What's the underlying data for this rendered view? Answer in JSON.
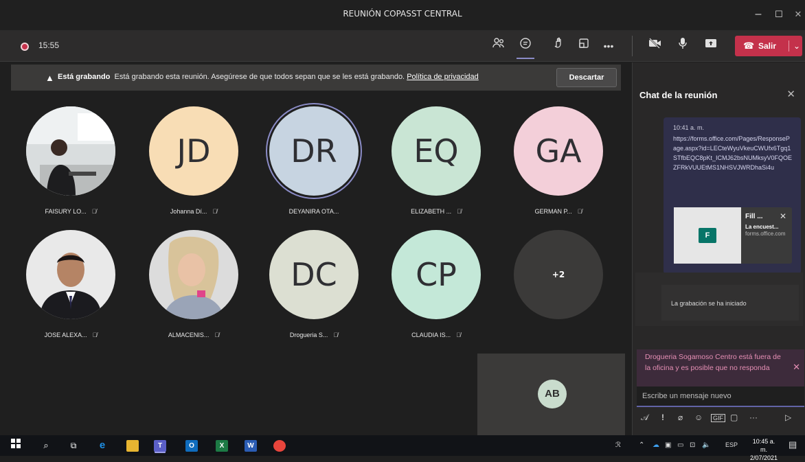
{
  "window": {
    "title": "REUNIÓN COPASST CENTRAL",
    "minimize": "–",
    "maximize": "☐",
    "close": "✕"
  },
  "toolbar": {
    "timer": "15:55",
    "leave_label": "Salir",
    "icons": [
      "participants-icon",
      "chat-icon",
      "reactions-icon",
      "rooms-icon",
      "more-icon",
      "camera-off-icon",
      "mic-icon",
      "share-icon"
    ]
  },
  "banner": {
    "bold": "Está grabando",
    "text": "Está grabando esta reunión. Asegúrese de que todos sepan que se les está grabando.",
    "policy_link": "Política de privacidad",
    "dismiss_label": "Descartar"
  },
  "participants": [
    {
      "initials": "",
      "name": "FAISURY LO...",
      "color": "",
      "photo": true
    },
    {
      "initials": "JD",
      "name": "Johanna Dí...",
      "color": "#f8ddb5"
    },
    {
      "initials": "DR",
      "name": "DEYANIRA OTA...",
      "color": "#c7d4e1"
    },
    {
      "initials": "EQ",
      "name": "ELIZABETH ...",
      "color": "#c9e5d4"
    },
    {
      "initials": "GA",
      "name": "GERMAN P...",
      "color": "#f3cfd9"
    },
    {
      "initials": "",
      "name": "JOSE ALEXA...",
      "color": "",
      "photo": true
    },
    {
      "initials": "",
      "name": "ALMACENIS...",
      "color": "",
      "photo": true
    },
    {
      "initials": "DC",
      "name": "Drogueria S...",
      "color": "#dcdfd2"
    },
    {
      "initials": "CP",
      "name": "CLAUDIA IS...",
      "color": "#c4e8d8"
    },
    {
      "initials": "+2",
      "name": "",
      "color": "#3b3a39"
    }
  ],
  "self_view": {
    "initials": "AB"
  },
  "chat": {
    "header": "Chat de la reunión",
    "message_time": "10:41 a. m.",
    "message_link": "https://forms.office.com/Pages/ResponsePage.aspx?id=LECteWyuVkeuCWUfx6Tgq1STfbEQC8pKt_ICMJ62bsNUMksyV0FQOEZFRkVUUEtMS1NHSVJWRDhaSi4u",
    "card_title": "Fill ...",
    "card_desc": "La encuest...",
    "card_url": "forms.office.com",
    "system_message": "La grabación se ha iniciado",
    "out_of_office": "Drogueria Sogamoso Centro está fuera de la oficina y es posible que no responda",
    "compose_placeholder": "Escribe un mensaje nuevo"
  },
  "taskbar": {
    "lang": "ESP",
    "time": "10:45 a. m.",
    "date": "2/07/2021"
  }
}
